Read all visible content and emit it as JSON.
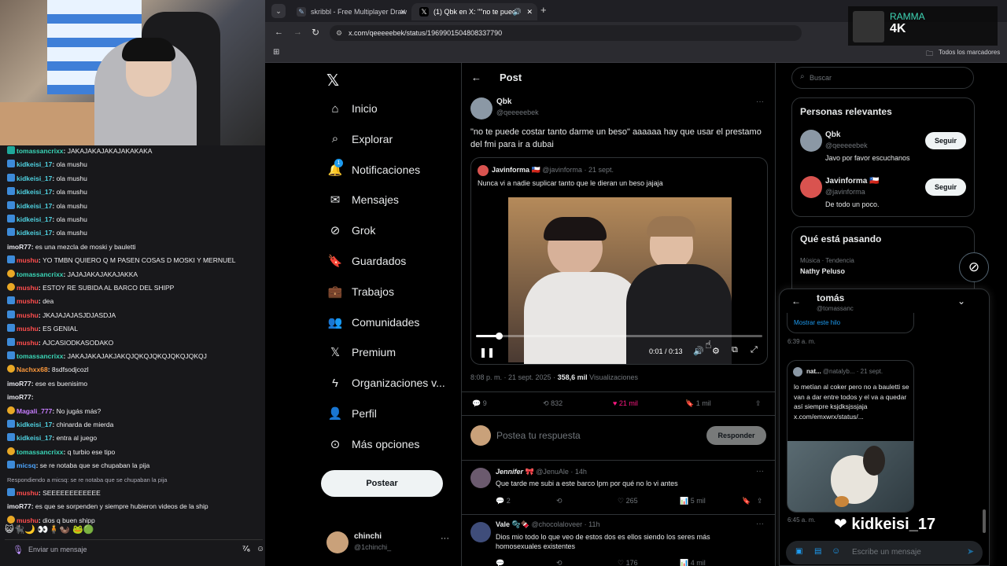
{
  "browser": {
    "tabs": [
      {
        "label": "skribbl - Free Multiplayer Draw",
        "icon": "pencil-icon"
      },
      {
        "label": "(1) Qbk en X: \"\"no te pued",
        "icon": "x-logo-icon"
      }
    ],
    "url": "x.com/qeeeeebek/status/1969901504808337790",
    "bookmarks_label": "Todos los marcadores"
  },
  "overlay": {
    "name": "RAMMA",
    "quality": "4K"
  },
  "nav": {
    "items": [
      {
        "label": "Inicio",
        "icon": "home-icon"
      },
      {
        "label": "Explorar",
        "icon": "search-icon"
      },
      {
        "label": "Notificaciones",
        "icon": "bell-icon",
        "badge": "1"
      },
      {
        "label": "Mensajes",
        "icon": "mail-icon"
      },
      {
        "label": "Grok",
        "icon": "grok-icon"
      },
      {
        "label": "Guardados",
        "icon": "bookmark-icon"
      },
      {
        "label": "Trabajos",
        "icon": "briefcase-icon"
      },
      {
        "label": "Comunidades",
        "icon": "people-icon"
      },
      {
        "label": "Premium",
        "icon": "x-logo-icon"
      },
      {
        "label": "Organizaciones v...",
        "icon": "lightning-icon"
      },
      {
        "label": "Perfil",
        "icon": "person-icon"
      },
      {
        "label": "Más opciones",
        "icon": "more-circle-icon"
      }
    ],
    "post_button": "Postear",
    "account": {
      "name": "chinchi",
      "handle": "@1chinchi_"
    }
  },
  "post": {
    "header": "Post",
    "author": "Qbk",
    "handle": "@qeeeeebek",
    "text": "\"no te puede costar tanto darme un beso\" aaaaaa hay que usar el prestamo del fmi para ir a dubai",
    "quote": {
      "author": "Javinforma",
      "handle": "@javinforma",
      "date": "· 21 sept.",
      "text": "Nunca vi a nadie suplicar tanto que le dieran un beso jajaja"
    },
    "video": {
      "time": "0:01 / 0:13",
      "progress": 0.08
    },
    "meta_time": "8:08 p. m. · 21 sept. 2025 · ",
    "views_count": "358,6 mil",
    "views_label": "Visualizaciones",
    "stats": {
      "replies": "9",
      "reposts": "832",
      "likes": "21 mil",
      "bookmarks": "1 mil"
    },
    "reply_placeholder": "Postea tu respuesta",
    "reply_button": "Responder"
  },
  "replies": [
    {
      "author": "Jennifer",
      "handle": "@JenuAle · 14h",
      "text": "Que tarde me subi a este barco lpm por qué no lo vi antes",
      "stats": {
        "replies": "2",
        "likes": "265",
        "views": "5 mil"
      }
    },
    {
      "author": "Vale",
      "handle": "@chocolaloveer · 11h",
      "text": "Dios mio todo lo que veo de estos dos es ellos siendo los seres más homosexuales existentes",
      "stats": {
        "likes": "176",
        "views": "4 mil"
      }
    }
  ],
  "sidebar": {
    "search_placeholder": "Buscar",
    "relevant_title": "Personas relevantes",
    "people": [
      {
        "name": "Qbk",
        "handle": "@qeeeeebek",
        "bio": "Javo por favor escuchanos",
        "button": "Seguir"
      },
      {
        "name": "Javinforma",
        "handle": "@javinforma",
        "bio": "De todo un poco.",
        "button": "Seguir"
      }
    ],
    "trending_title": "Qué está pasando",
    "trend": {
      "category": "Música · Tendencia",
      "name": "Nathy Peluso"
    }
  },
  "dm": {
    "name": "tomás",
    "handle": "@tomassanc",
    "show_thread": "Mostrar este hilo",
    "time1": "6:39 a. m.",
    "shared": {
      "author": "nat...",
      "handle": "@natalyb...",
      "date": "· 21 sept.",
      "text": "lo metían al coker pero no a bauletti se van a dar entre todos y el va a quedar así siempre ksjdksjssjaja x.com/emxwrx/status/..."
    },
    "time2": "6:45 a. m.",
    "input_placeholder": "Escribe un mensaje"
  },
  "donation": {
    "name": "kidkeisi_17"
  },
  "chat": {
    "input_placeholder": "Enviar un mensaje",
    "messages": [
      {
        "user": "tomassancrixx",
        "color": "#3ad6b7",
        "text": "JAKAJAKAJAKAJAKAKAKA",
        "badge": "teal"
      },
      {
        "user": "kidkeisi_17",
        "color": "#4fd1e0",
        "text": "ola mushu",
        "badge": "blue"
      },
      {
        "user": "kidkeisi_17",
        "color": "#4fd1e0",
        "text": "ola mushu",
        "badge": "blue"
      },
      {
        "user": "kidkeisi_17",
        "color": "#4fd1e0",
        "text": "ola mushu",
        "badge": "blue"
      },
      {
        "user": "kidkeisi_17",
        "color": "#4fd1e0",
        "text": "ola mushu",
        "badge": "blue"
      },
      {
        "user": "kidkeisi_17",
        "color": "#4fd1e0",
        "text": "ola mushu",
        "badge": "blue"
      },
      {
        "user": "kidkeisi_17",
        "color": "#4fd1e0",
        "text": "ola mushu",
        "badge": "blue"
      },
      {
        "user": "imoR77",
        "color": "#e8e8ee",
        "text": "es una mezcla de moski y bauletti",
        "badge": ""
      },
      {
        "user": "mushu",
        "color": "#ff4d4d",
        "text": "YO TMBN QUIERO Q M PASEN COSAS D MOSKI Y MERNUEL",
        "badge": "blue"
      },
      {
        "user": "tomassancrixx",
        "color": "#3ad6b7",
        "text": "JAJAJAKAJAKAJAKKA",
        "badge": "gold"
      },
      {
        "user": "mushu",
        "color": "#ff4d4d",
        "text": "ESTOY RE SUBIDA AL BARCO DEL SHIPP",
        "badge": "gold"
      },
      {
        "user": "mushu",
        "color": "#ff4d4d",
        "text": "dea",
        "badge": "blue"
      },
      {
        "user": "mushu",
        "color": "#ff4d4d",
        "text": "JKAJAJAJASJDJASDJA",
        "badge": "blue"
      },
      {
        "user": "mushu",
        "color": "#ff4d4d",
        "text": "ES GENIAL",
        "badge": "blue"
      },
      {
        "user": "mushu",
        "color": "#ff4d4d",
        "text": "AJCASIODKASODAKO",
        "badge": "blue"
      },
      {
        "user": "tomassancrixx",
        "color": "#3ad6b7",
        "text": "JAKAJAKAJAKJAKQJQKQJQKQJQKQJQKQJ",
        "badge": "blue"
      },
      {
        "user": "Nachxx68",
        "color": "#ff9a3c",
        "text": "8sdfsodjcozl",
        "badge": "gold"
      },
      {
        "user": "imoR77",
        "color": "#e8e8ee",
        "text": "ese es buenisimo",
        "badge": ""
      },
      {
        "user": "imoR77",
        "color": "#e8e8ee",
        "text": "",
        "badge": ""
      },
      {
        "user": "Magali_777",
        "color": "#c77dff",
        "text": "No jugás más?",
        "badge": "gold"
      },
      {
        "user": "kidkeisi_17",
        "color": "#4fd1e0",
        "text": "chinarda de mierda",
        "badge": "blue"
      },
      {
        "user": "kidkeisi_17",
        "color": "#4fd1e0",
        "text": "entra al juego",
        "badge": "blue"
      },
      {
        "user": "tomassancrixx",
        "color": "#3ad6b7",
        "text": "q turbio ese tipo",
        "badge": "gold"
      },
      {
        "user": "micsq",
        "color": "#4da6ff",
        "text": "se re notaba que se chupaban la pija",
        "badge": "blue"
      },
      {
        "user": "",
        "color": "#adadb8",
        "text": "Respondiendo a micsq: se re notaba que se chupaban la pija",
        "badge": "",
        "reply": true
      },
      {
        "user": "mushu",
        "color": "#ff4d4d",
        "text": "SEEEEEEEEEEEE",
        "badge": "blue"
      },
      {
        "user": "imoR77",
        "color": "#e8e8ee",
        "text": "es que se sorpenden y siempre hubieron videos de la ship",
        "badge": ""
      },
      {
        "user": "mushu",
        "color": "#ff4d4d",
        "text": "dios q buen shipp",
        "badge": "gold"
      }
    ]
  }
}
